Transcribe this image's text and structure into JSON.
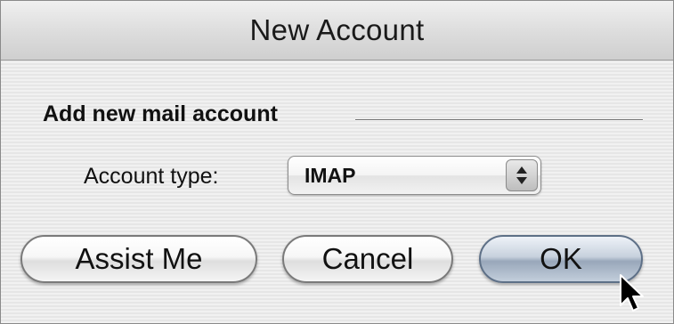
{
  "window": {
    "title": "New Account"
  },
  "section": {
    "label": "Add new mail account"
  },
  "account_type": {
    "label": "Account type:",
    "selected_value": "IMAP"
  },
  "buttons": {
    "assist_label": "Assist Me",
    "cancel_label": "Cancel",
    "ok_label": "OK"
  },
  "icons": {
    "popup_arrows": "up-down-arrows-icon",
    "cursor": "mouse-pointer-icon"
  },
  "colors": {
    "default_button": "#98a7ba",
    "background_stripe": "#e6e6e6"
  }
}
